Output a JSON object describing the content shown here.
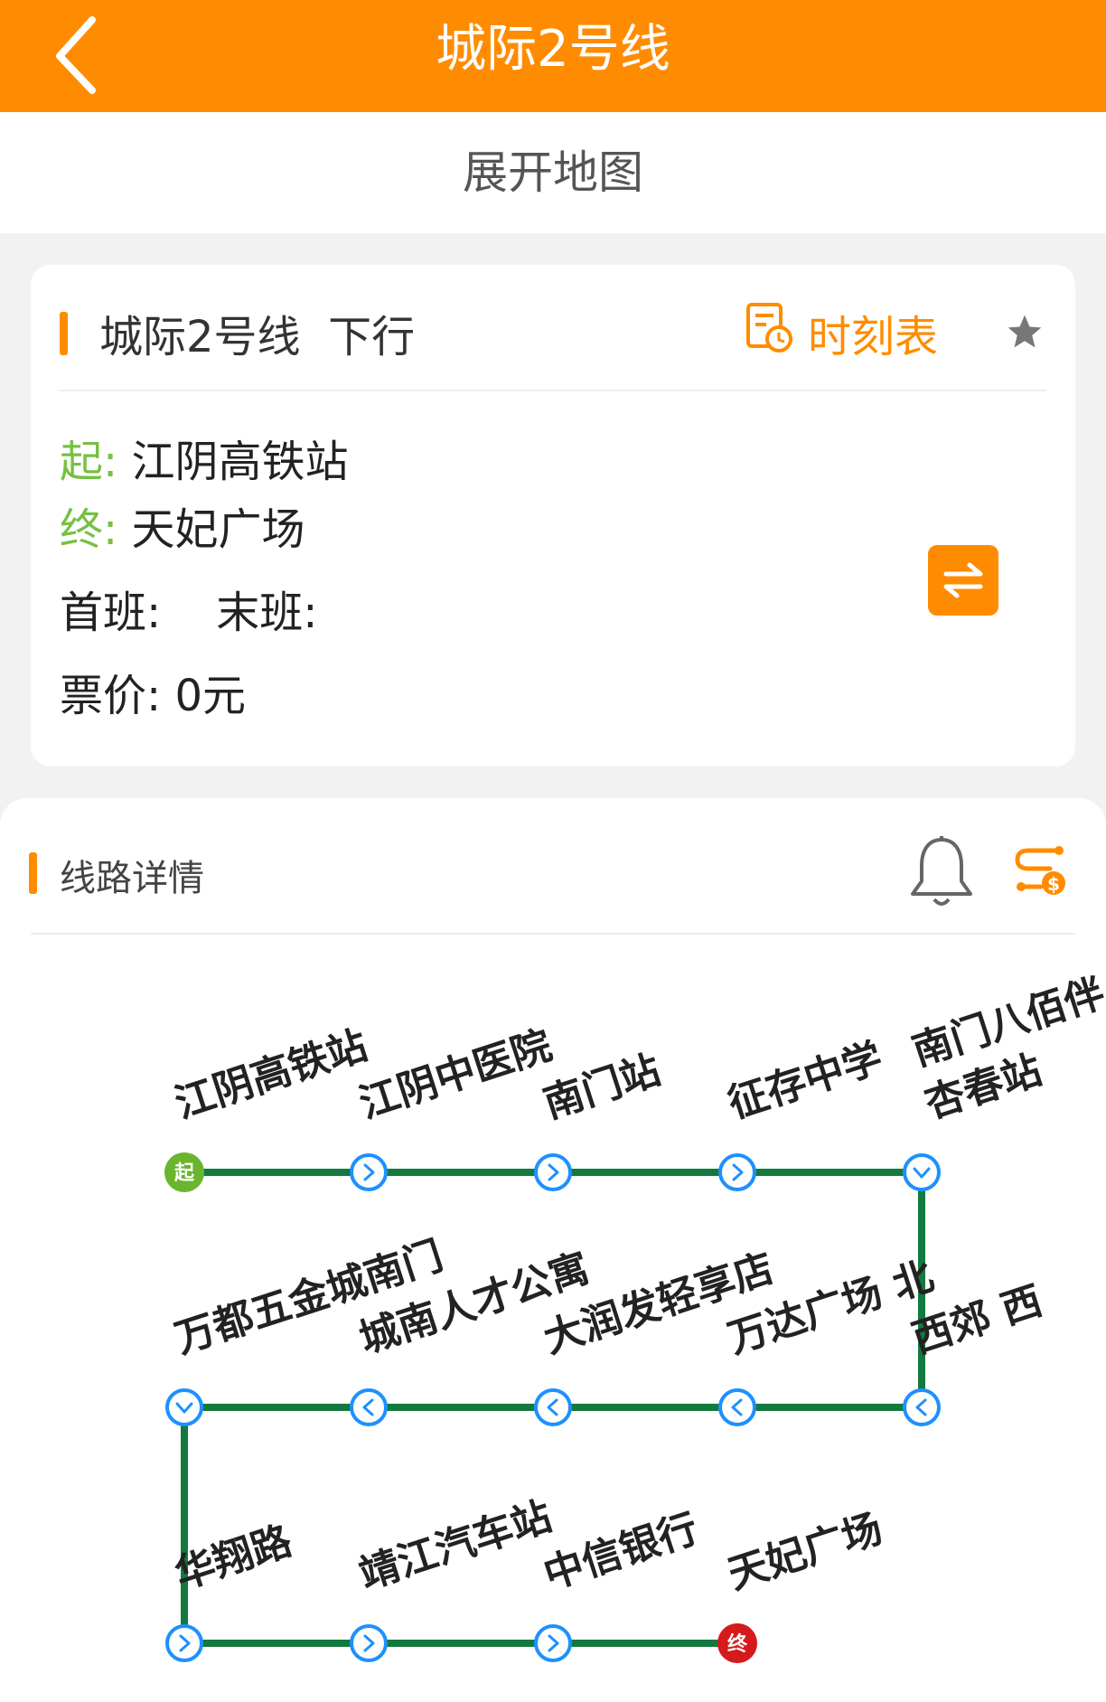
{
  "header": {
    "title": "城际2号线",
    "back_icon": "chevron-left-icon",
    "color": "#ff8c00"
  },
  "expand_map": {
    "label": "展开地图"
  },
  "info": {
    "line_name": "城际2号线",
    "direction": "下行",
    "timetable_label": "时刻表",
    "timetable_icon": "schedule-icon",
    "favorite_icon": "star-icon",
    "start_label": "起:",
    "start_station": "江阴高铁站",
    "end_label": "终:",
    "end_station": "天妃广场",
    "first_bus_label": "首班:",
    "last_bus_label": "末班:",
    "fare_label": "票价:",
    "fare_value": "0元",
    "swap_icon": "swap-direction-icon"
  },
  "route": {
    "title": "线路详情",
    "bell_icon": "bell-icon",
    "plan_icon": "route-plan-icon",
    "line_color": "#127a3e",
    "node_color": "#1e90ff",
    "start_badge": "起",
    "end_badge": "终",
    "start_badge_color": "#6ab52d",
    "end_badge_color": "#d41a1a",
    "stations": [
      {
        "name": "江阴高铁站",
        "node": "start"
      },
      {
        "name": "江阴中医院",
        "node": "arrow-right"
      },
      {
        "name": "南门站",
        "node": "arrow-right"
      },
      {
        "name": "征存中学",
        "node": "arrow-right"
      },
      {
        "name": "南门八佰伴杏春站",
        "line1": "南门八佰伴",
        "line2": "杏春站",
        "node": "arrow-down"
      },
      {
        "name": "西郊 西",
        "node": "arrow-left"
      },
      {
        "name": "万达广场 北",
        "node": "arrow-left"
      },
      {
        "name": "大润发轻享店",
        "node": "arrow-left"
      },
      {
        "name": "城南人才公寓",
        "node": "arrow-left"
      },
      {
        "name": "万都五金城南门",
        "node": "arrow-down"
      },
      {
        "name": "华翔路",
        "node": "arrow-right"
      },
      {
        "name": "靖江汽车站",
        "node": "arrow-right"
      },
      {
        "name": "中信银行",
        "node": "arrow-right"
      },
      {
        "name": "天妃广场",
        "node": "end"
      }
    ]
  }
}
